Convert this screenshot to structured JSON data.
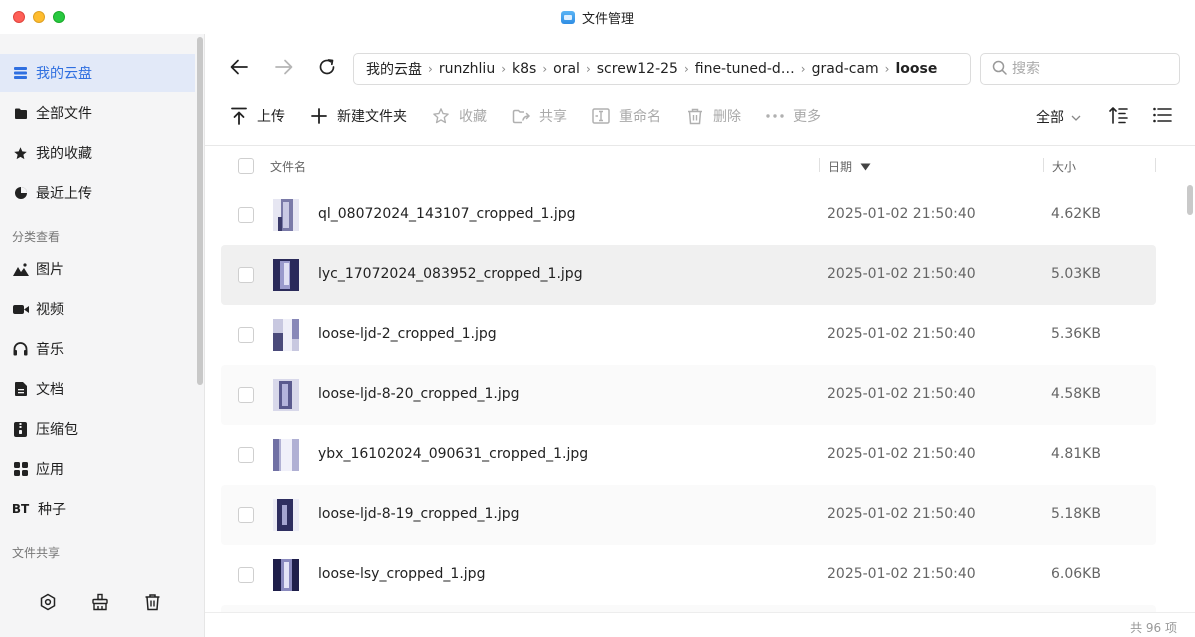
{
  "window": {
    "title": "文件管理"
  },
  "sidebar": {
    "items": [
      {
        "label": "我的云盘",
        "icon": "cloud-drive-icon",
        "active": true
      },
      {
        "label": "全部文件",
        "icon": "folder-icon"
      },
      {
        "label": "我的收藏",
        "icon": "star-icon"
      },
      {
        "label": "最近上传",
        "icon": "recent-icon"
      }
    ],
    "group_category": "分类查看",
    "category_items": [
      {
        "label": "图片",
        "icon": "image-icon"
      },
      {
        "label": "视频",
        "icon": "video-icon"
      },
      {
        "label": "音乐",
        "icon": "headphones-icon"
      },
      {
        "label": "文档",
        "icon": "document-icon"
      },
      {
        "label": "压缩包",
        "icon": "archive-icon"
      },
      {
        "label": "应用",
        "icon": "apps-icon"
      },
      {
        "label": "种子",
        "icon": "bt-icon",
        "badge": "BT"
      }
    ],
    "group_share": "文件共享",
    "bottom_icons": [
      "settings-icon",
      "cleanup-icon",
      "trash-icon"
    ]
  },
  "breadcrumb": [
    "我的云盘",
    "runzhliu",
    "k8s",
    "oral",
    "screw12-25",
    "fine-tuned-d…",
    "grad-cam",
    "loose"
  ],
  "search": {
    "placeholder": "搜索"
  },
  "toolbar": {
    "upload": "上传",
    "new_folder": "新建文件夹",
    "favorite": "收藏",
    "share": "共享",
    "rename": "重命名",
    "delete": "删除",
    "more": "更多",
    "filter": "全部"
  },
  "table": {
    "headers": {
      "name": "文件名",
      "date": "日期",
      "size": "大小"
    },
    "rows": [
      {
        "name": "ql_08072024_143107_cropped_1.jpg",
        "date": "2025-01-02 21:50:40",
        "size": "4.62KB"
      },
      {
        "name": "lyc_17072024_083952_cropped_1.jpg",
        "date": "2025-01-02 21:50:40",
        "size": "5.03KB"
      },
      {
        "name": "loose-ljd-2_cropped_1.jpg",
        "date": "2025-01-02 21:50:40",
        "size": "5.36KB"
      },
      {
        "name": "loose-ljd-8-20_cropped_1.jpg",
        "date": "2025-01-02 21:50:40",
        "size": "4.58KB"
      },
      {
        "name": "ybx_16102024_090631_cropped_1.jpg",
        "date": "2025-01-02 21:50:40",
        "size": "4.81KB"
      },
      {
        "name": "loose-ljd-8-19_cropped_1.jpg",
        "date": "2025-01-02 21:50:40",
        "size": "5.18KB"
      },
      {
        "name": "loose-lsy_cropped_1.jpg",
        "date": "2025-01-02 21:50:40",
        "size": "6.06KB"
      }
    ]
  },
  "footer": {
    "count": "共 96 项"
  },
  "colors": {
    "accent": "#2f6fe0",
    "active_bg": "#e2e9f8",
    "sidebar_bg": "#f5f5f6"
  }
}
